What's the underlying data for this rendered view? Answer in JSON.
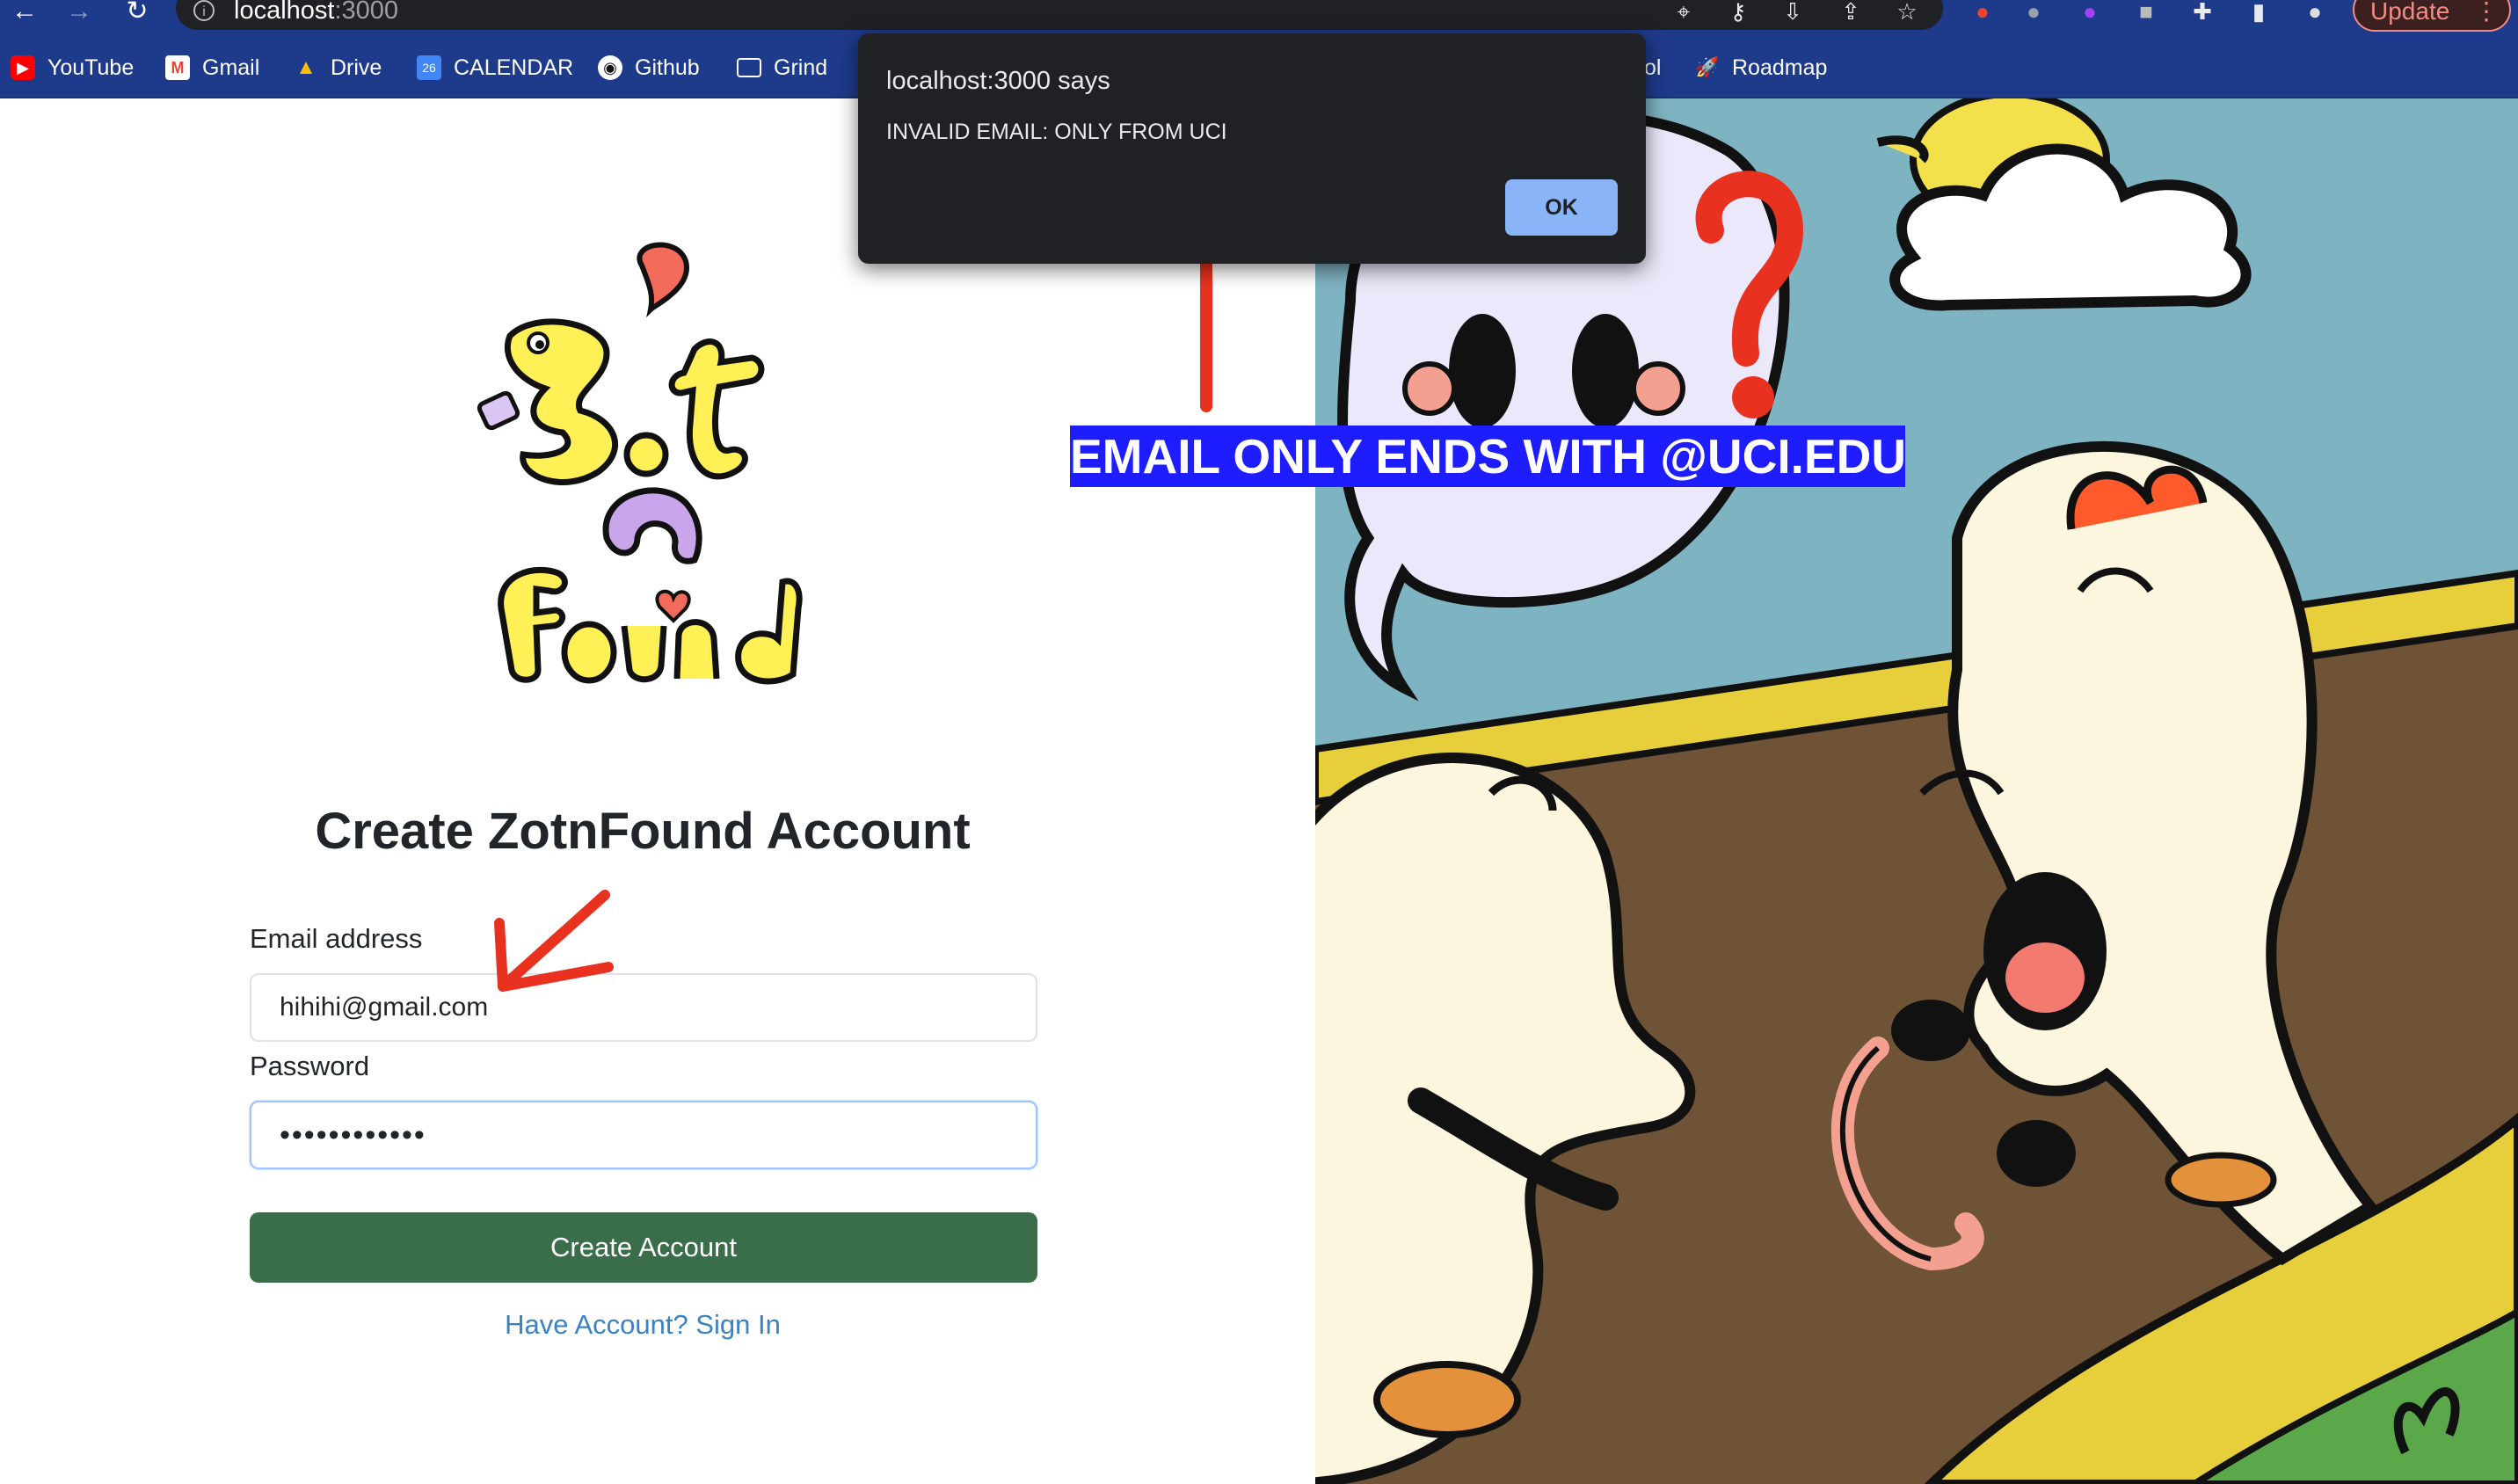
{
  "browser": {
    "url_host": "localhost",
    "url_port": ":3000",
    "update_label": "Update",
    "bookmarks": [
      "YouTube",
      "Gmail",
      "Drive",
      "CALENDAR",
      "Github",
      "Grind",
      "ol",
      "Roadmap"
    ],
    "calendar_day": "26"
  },
  "page": {
    "title": "Create ZotnFound Account",
    "email_label": "Email address",
    "email_value": "hihihi@gmail.com",
    "password_label": "Password",
    "password_value": "••••••••••••",
    "create_button": "Create Account",
    "signin_link": "Have Account? Sign In"
  },
  "dialog": {
    "title": "localhost:3000 says",
    "message": "INVALID EMAIL: ONLY FROM UCI",
    "ok_label": "OK"
  },
  "annotation": {
    "banner": "EMAIL ONLY ENDS WITH @UCI.EDU",
    "arrow_color": "#e8321f",
    "banner_color": "#1d1dff"
  },
  "colors": {
    "chrome": "#1e3a8a",
    "primary_button": "#3a6e4b",
    "link": "#3b82c4",
    "dialog_bg": "#202124",
    "dialog_button": "#8ab4f8"
  }
}
